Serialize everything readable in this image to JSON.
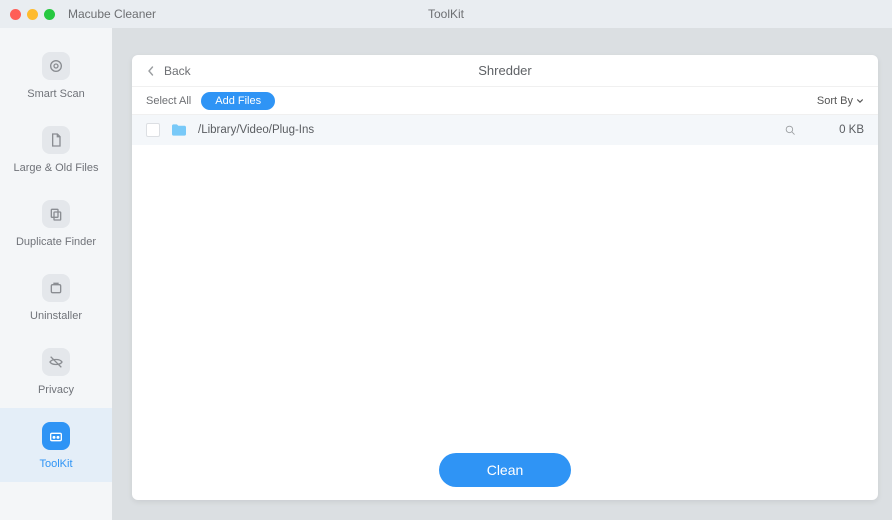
{
  "titlebar": {
    "app_name": "Macube Cleaner",
    "section": "ToolKit"
  },
  "sidebar": {
    "items": [
      {
        "label": "Smart Scan"
      },
      {
        "label": "Large & Old Files"
      },
      {
        "label": "Duplicate Finder"
      },
      {
        "label": "Uninstaller"
      },
      {
        "label": "Privacy"
      },
      {
        "label": "ToolKit"
      }
    ]
  },
  "panel": {
    "back_label": "Back",
    "title": "Shredder",
    "select_all_label": "Select All",
    "add_files_label": "Add Files",
    "sort_by_label": "Sort By",
    "clean_label": "Clean",
    "rows": [
      {
        "path": "/Library/Video/Plug-Ins",
        "size": "0 KB"
      }
    ]
  }
}
